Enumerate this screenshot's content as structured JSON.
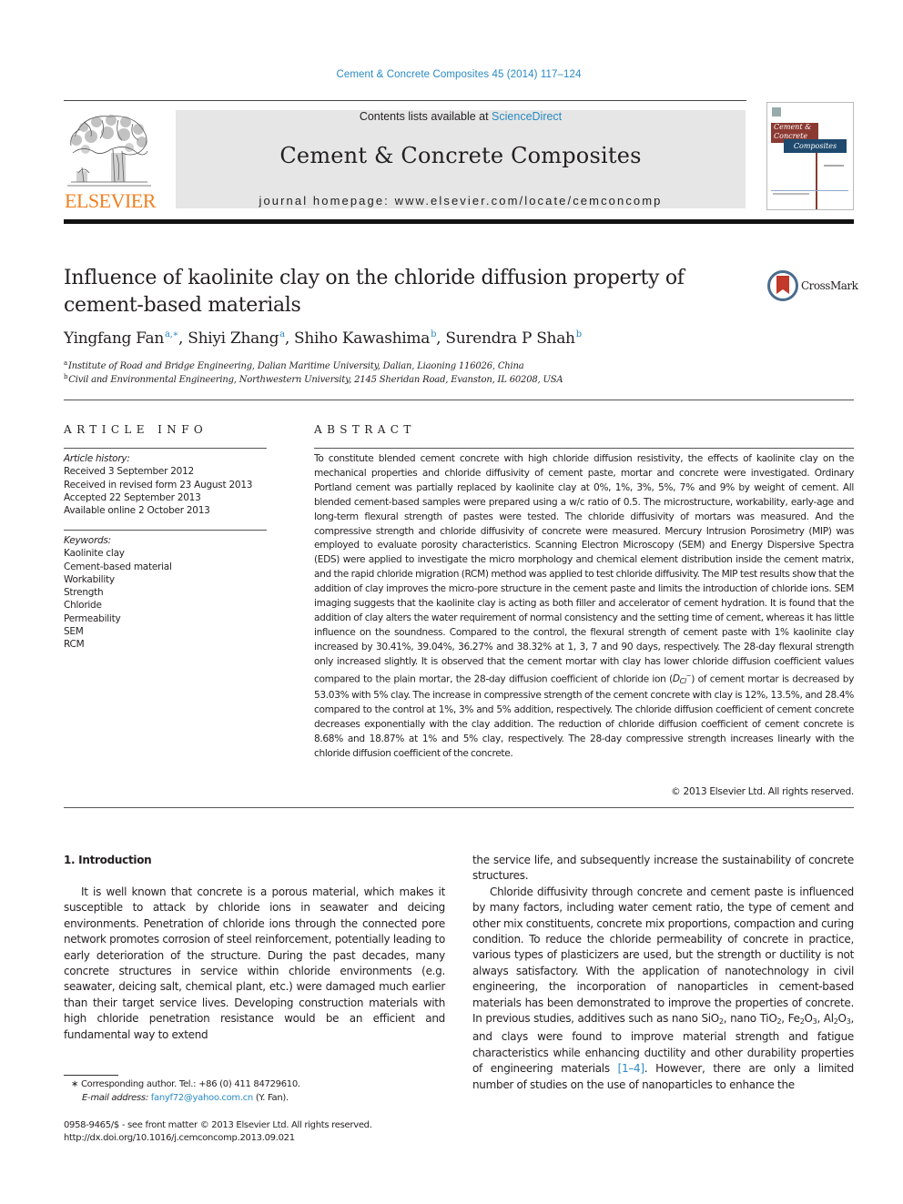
{
  "journal_ref": "Cement & Concrete Composites 45 (2014) 117–124",
  "header": {
    "publisher": "ELSEVIER",
    "contents_prefix": "Contents lists available at ",
    "contents_link": "ScienceDirect",
    "journal_title": "Cement & Concrete Composites",
    "homepage": "journal homepage: www.elsevier.com/locate/cemconcomp",
    "cover": {
      "line1": "Cement &",
      "line2": "Concrete",
      "line3": "Composites"
    },
    "colors": {
      "publisher_orange": "#f07f1f",
      "link_blue": "#2a8ac4",
      "band_gray": "#e6e6e6",
      "cover_red": "#8b3a32",
      "cover_blue": "#1f4a6e"
    }
  },
  "article": {
    "title": "Influence of kaolinite clay on the chloride diffusion property of cement-based materials",
    "crossmark_label": "CrossMark",
    "authors": [
      {
        "name": "Yingfang Fan",
        "sup": "a,∗",
        "sep": ", "
      },
      {
        "name": "Shiyi Zhang",
        "sup": "a",
        "sep": ", "
      },
      {
        "name": "Shiho Kawashima",
        "sup": "b",
        "sep": ", "
      },
      {
        "name": "Surendra P Shah",
        "sup": "b",
        "sep": ""
      }
    ],
    "affiliations": [
      {
        "label": "a",
        "text": "Institute of Road and Bridge Engineering, Dalian Maritime University, Dalian, Liaoning 116026, China"
      },
      {
        "label": "b",
        "text": "Civil and Environmental Engineering, Northwestern University, 2145 Sheridan Road, Evanston, IL 60208, USA"
      }
    ]
  },
  "article_info": {
    "heading": "ARTICLE INFO",
    "history_label": "Article history:",
    "history": [
      "Received 3 September 2012",
      "Received in revised form 23 August 2013",
      "Accepted 22 September 2013",
      "Available online 2 October 2013"
    ],
    "keywords_label": "Keywords:",
    "keywords": [
      "Kaolinite clay",
      "Cement-based material",
      "Workability",
      "Strength",
      "Chloride",
      "Permeability",
      "SEM",
      "RCM"
    ]
  },
  "abstract": {
    "heading": "ABSTRACT",
    "text_part1": "To constitute blended cement concrete with high chloride diffusion resistivity, the effects of kaolinite clay on the mechanical properties and chloride diffusivity of cement paste, mortar and concrete were investigated. Ordinary Portland cement was partially replaced by kaolinite clay at 0%, 1%, 3%, 5%, 7% and 9% by weight of cement. All blended cement-based samples were prepared using a w/c ratio of 0.5. The microstructure, workability, early-age and long-term flexural strength of pastes were tested. The chloride diffusivity of mortars was measured. And the compressive strength and chloride diffusivity of concrete were measured. Mercury Intrusion Porosimetry (MIP) was employed to evaluate porosity characteristics. Scanning Electron Microscopy (SEM) and Energy Dispersive Spectra (EDS) were applied to investigate the micro morphology and chemical element distribution inside the cement matrix, and the rapid chloride migration (RCM) method was applied to test chloride diffusivity. The MIP test results show that the addition of clay improves the micro-pore structure in the cement paste and limits the introduction of chloride ions. SEM imaging suggests that the kaolinite clay is acting as both filler and accelerator of cement hydration. It is found that the addition of clay alters the water requirement of normal consistency and the setting time of cement, whereas it has little influence on the soundness. Compared to the control, the flexural strength of cement paste with 1% kaolinite clay increased by 30.41%, 39.04%, 36.27% and 38.32% at 1, 3, 7 and 90 days, respectively. The 28-day flexural strength only increased slightly. It is observed that the cement mortar with clay has lower chloride diffusion coefficient values compared to the plain mortar, the 28-day diffusion coefficient of chloride ion ",
    "symbol_main": "D",
    "symbol_sub": "Cl",
    "symbol_sup": "−",
    "text_part2": " of cement mortar is decreased by 53.03% with 5% clay. The increase in compressive strength of the cement concrete with clay is 12%, 13.5%, and 28.4% compared to the control at 1%, 3% and 5% addition, respectively. The chloride diffusion coefficient of cement concrete decreases exponentially with the clay addition. The reduction of chloride diffusion coefficient of cement concrete is 8.68% and 18.87% at 1% and 5% clay, respectively. The 28-day compressive strength increases linearly with the chloride diffusion coefficient of the concrete.",
    "copyright": "© 2013 Elsevier Ltd. All rights reserved."
  },
  "body": {
    "intro_heading": "1. Introduction",
    "left_p1": "It is well known that concrete is a porous material, which makes it susceptible to attack by chloride ions in seawater and deicing environments. Penetration of chloride ions through the connected pore network promotes corrosion of steel reinforcement, potentially leading to early deterioration of the structure. During the past decades, many concrete structures in service within chloride environments (e.g. seawater, deicing salt, chemical plant, etc.) were damaged much earlier than their target service lives. Developing construction materials with high chloride penetration resistance would be an efficient and fundamental way to extend",
    "right_p0": "the service life, and subsequently increase the sustainability of concrete structures.",
    "right_p1_a": "Chloride diffusivity through concrete and cement paste is influenced by many factors, including water cement ratio, the type of cement and other mix constituents, concrete mix proportions, compaction and curing condition. To reduce the chloride permeability of concrete in practice, various types of plasticizers are used, but the strength or ductility is not always satisfactory. With the application of nanotechnology in civil engineering, the incorporation of nanoparticles in cement-based materials has been demonstrated to improve the properties of concrete. In previous studies, additives such as nano SiO",
    "right_p1_b": ", nano TiO",
    "right_p1_c": ", Fe",
    "right_p1_d": "O",
    "right_p1_e": ", Al",
    "right_p1_f": "O",
    "right_p1_g": ", and clays were found to improve material strength and fatigue characteristics while enhancing ductility and other durability properties of engineering materials ",
    "right_p1_ref": "[1–4]",
    "right_p1_h": ". However, there are only a limited number of studies on the use of nanoparticles to enhance the",
    "sub_2": "2",
    "sub_3": "3"
  },
  "footnotes": {
    "corresponding": "∗  Corresponding author. Tel.: +86 (0) 411 84729610.",
    "email_label": "E-mail address: ",
    "email": "fanyf72@yahoo.com.cn",
    "email_suffix": " (Y. Fan).",
    "issn_line": "0958-9465/$ - see front matter © 2013 Elsevier Ltd. All rights reserved.",
    "doi": "http://dx.doi.org/10.1016/j.cemconcomp.2013.09.021"
  }
}
